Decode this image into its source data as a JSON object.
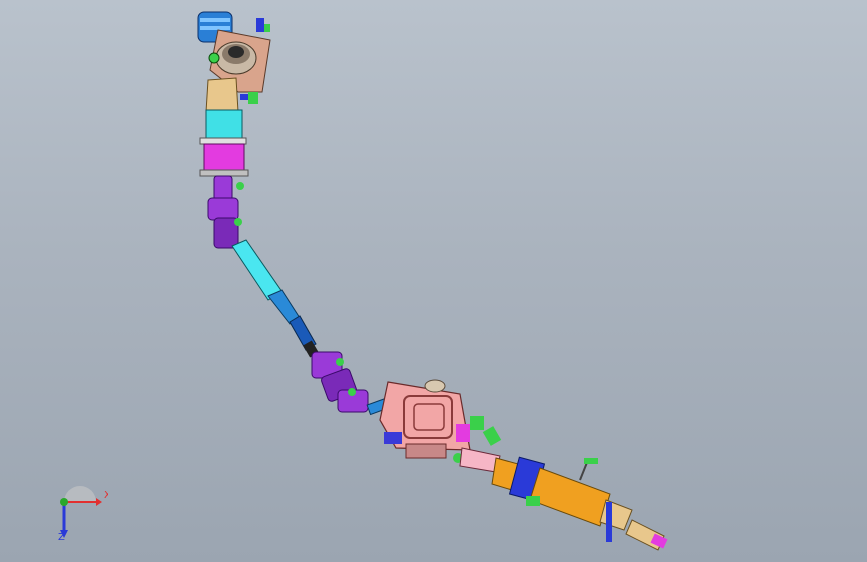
{
  "viewport": {
    "background_top": "#b9c2cc",
    "background_bottom": "#9ba5b1"
  },
  "triad": {
    "x_label": "X",
    "y_label": "Y",
    "z_label": "Z",
    "x_color": "#e23030",
    "y_color": "#2aa82a",
    "z_color": "#2a3ad8"
  },
  "model": {
    "icon": "steering-column-assembly"
  }
}
